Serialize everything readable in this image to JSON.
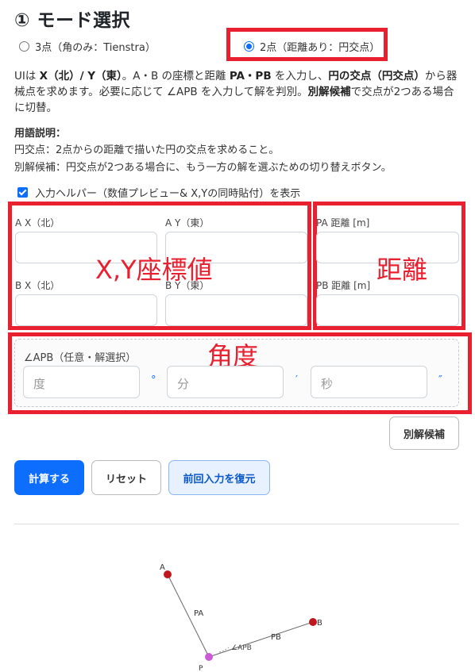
{
  "title": "① モード選択",
  "modes": [
    {
      "label": "3点（角のみ：Tienstra）",
      "selected": false
    },
    {
      "label": "2点（距離あり：円交点）",
      "selected": true
    }
  ],
  "description": {
    "p1": "UIは ",
    "b1": "X（北）/ Y（東）",
    "p2": "。A・B の座標と距離 ",
    "b2": "PA・PB",
    "p3": " を入力し、",
    "b3": "円の交点（円交点）",
    "p4": "から器械点を求めます。必要に応じて ∠APB を入力して解を判別。",
    "b4": "別解候補",
    "p5": "で交点が2つある場合に切替。"
  },
  "terms": {
    "heading": "用語説明：",
    "line1": "円交点：2点からの距離で描いた円の交点を求めること。",
    "line2": "別解候補：円交点が2つある場合に、もう一方の解を選ぶための切り替えボタン。"
  },
  "helper": {
    "label": "入力ヘルパー（数値プレビュー& X,Yの同時貼付）を表示",
    "checked": true
  },
  "coords": {
    "ax_label": "A X（北）",
    "ay_label": "A Y（東）",
    "bx_label": "B X（北）",
    "by_label": "B Y（東）",
    "annotation": "X,Y座標値"
  },
  "distance": {
    "pa_label": "PA 距離 [m]",
    "pb_label": "PB 距離 [m]",
    "annotation": "距離"
  },
  "angle": {
    "label": "∠APB（任意・解選択）",
    "deg_placeholder": "度",
    "deg_unit": "°",
    "min_placeholder": "分",
    "min_unit": "′",
    "sec_placeholder": "秒",
    "sec_unit": "″",
    "annotation": "角度"
  },
  "buttons": {
    "alt_solution": "別解候補",
    "calculate": "計算する",
    "reset": "リセット",
    "restore": "前回入力を復元"
  },
  "diagram": {
    "point_a": "A",
    "point_b": "B",
    "point_p": "P",
    "line_pa": "PA",
    "line_pb": "PB",
    "angle": "∠APB",
    "colors": {
      "ab_points": "#c0171f",
      "p_point": "#c95bd6"
    }
  }
}
